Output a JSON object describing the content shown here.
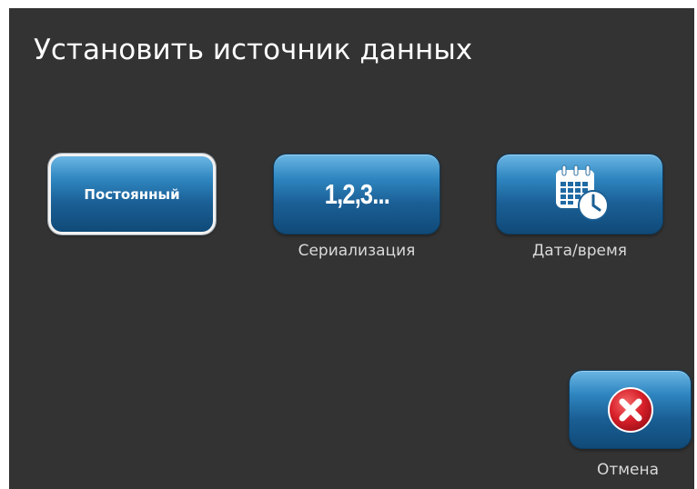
{
  "title": "Установить источник данных",
  "options": {
    "constant": {
      "label": "Постоянный",
      "selected": true
    },
    "serialization": {
      "icon_text": "1,2,3...",
      "caption": "Сериализация"
    },
    "datetime": {
      "icon": "calendar-clock-icon",
      "caption": "Дата/время"
    }
  },
  "cancel": {
    "icon": "close-icon",
    "caption": "Отмена"
  },
  "colors": {
    "background": "#333333",
    "button_blue": "#1a5f95",
    "cancel_red": "#d8202a",
    "text": "#ffffff"
  }
}
